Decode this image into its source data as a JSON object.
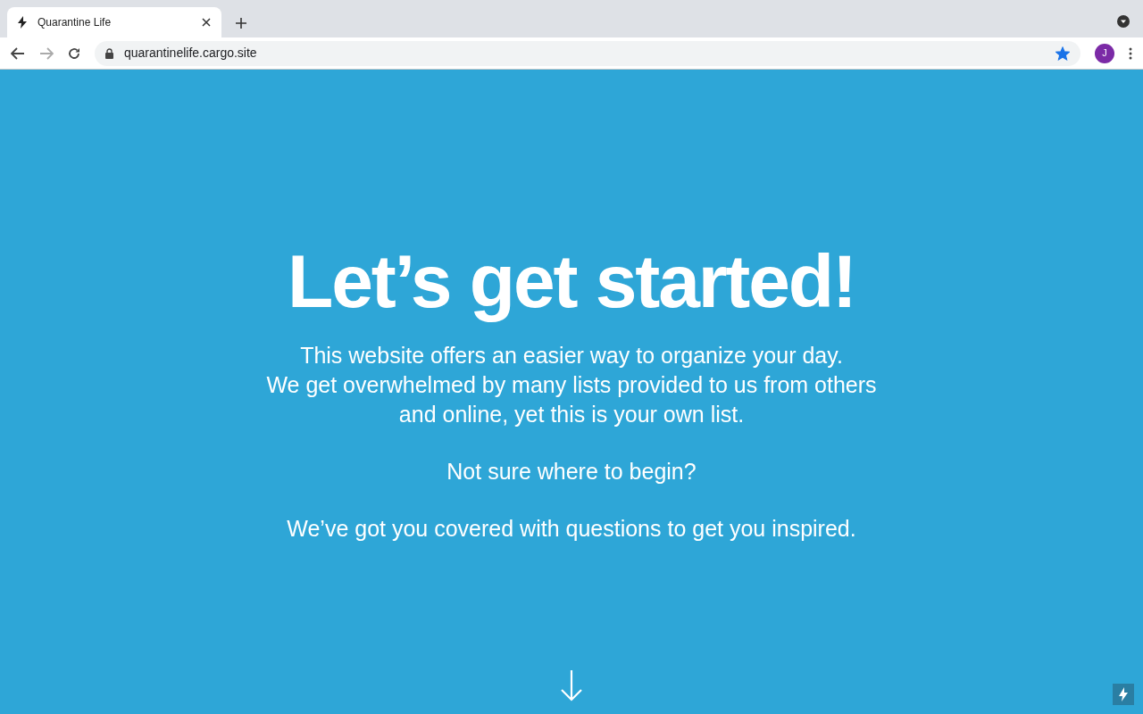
{
  "browser": {
    "tab": {
      "title": "Quarantine Life",
      "selected": true
    },
    "url": "quarantinelife.cargo.site",
    "bookmarked": true,
    "avatar": "J"
  },
  "page": {
    "heading": "Let’s get started!",
    "paragraphs": [
      {
        "lines": [
          "This website offers an easier way to organize your day.",
          "We get overwhelmed by many lists provided to us from others",
          "and online, yet this is your own list."
        ]
      },
      {
        "lines": [
          "Not sure where to begin?"
        ]
      },
      {
        "lines": [
          "We’ve got you covered with questions to get you inspired."
        ]
      }
    ]
  }
}
